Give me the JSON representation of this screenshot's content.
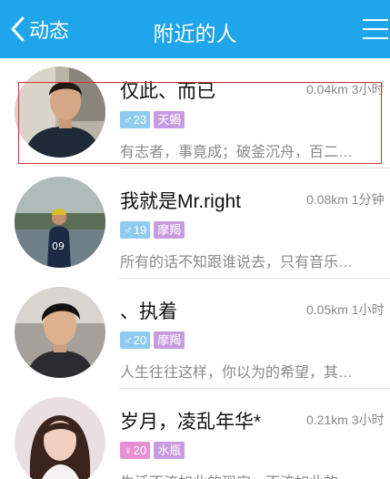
{
  "header": {
    "back_label": "动态",
    "title": "附近的人"
  },
  "colors": {
    "header_bg": "#1fa5ea",
    "male_badge": "#8fcbef",
    "female_badge": "#e58fd6",
    "sign_badge": "#c79be0",
    "highlight_box": "#c8343a"
  },
  "people": [
    {
      "name": "仅此、而已",
      "distance_time": "0.04km 3小时",
      "gender": "male",
      "gender_symbol": "♂",
      "age": "23",
      "tag": "天蝎",
      "snippet": "有志者，事竟成；破釜沉舟，百二…"
    },
    {
      "name": "我就是Mr.right",
      "distance_time": "0.08km 1分钟",
      "gender": "male",
      "gender_symbol": "♂",
      "age": "19",
      "tag": "摩羯",
      "snippet": "所有的话不知跟谁说去，只有音乐…"
    },
    {
      "name": "、执着",
      "distance_time": "0.05km 1小时",
      "gender": "male",
      "gender_symbol": "♂",
      "age": "20",
      "tag": "摩羯",
      "snippet": "人生往往这样，你以为的希望，其…"
    },
    {
      "name": "岁月，凌乱年华*",
      "distance_time": "0.21km 3小时",
      "gender": "female",
      "gender_symbol": "♀",
      "age": "20",
      "tag": "水瓶",
      "snippet": "生活不流如此的现实，不流如此的…"
    }
  ]
}
